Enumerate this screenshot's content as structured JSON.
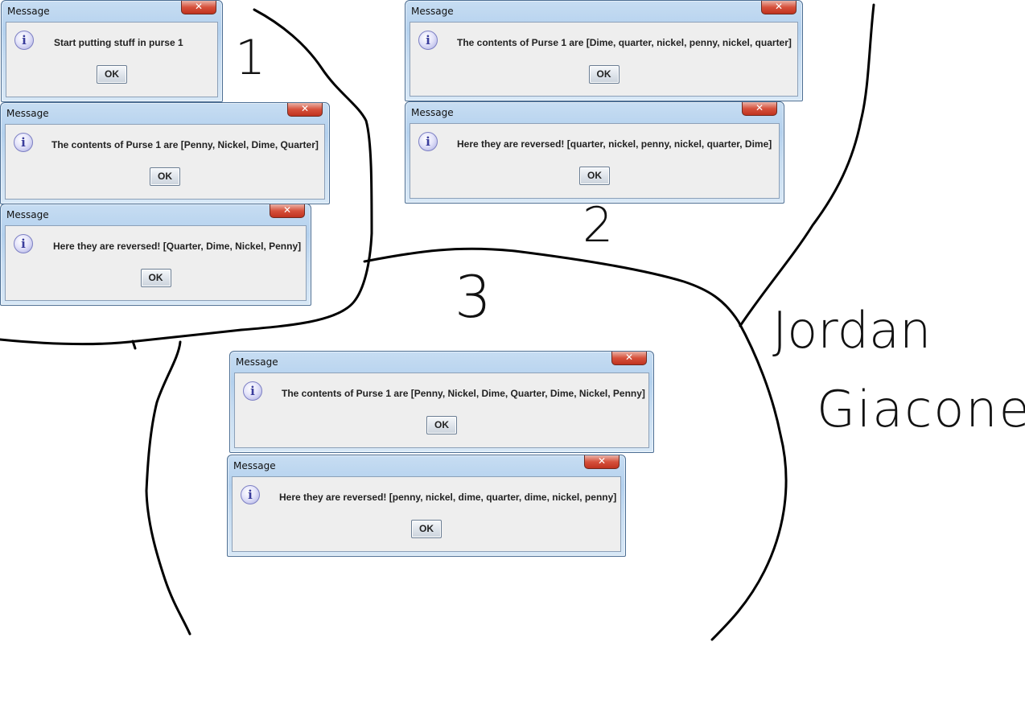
{
  "dialogs": [
    {
      "title": "Message",
      "message": "Start putting stuff in purse 1",
      "ok_label": "OK"
    },
    {
      "title": "Message",
      "message": "The contents of Purse 1 are [Penny, Nickel, Dime, Quarter]",
      "ok_label": "OK"
    },
    {
      "title": "Message",
      "message": "Here they are reversed! [Quarter, Dime, Nickel, Penny]",
      "ok_label": "OK"
    },
    {
      "title": "Message",
      "message": "The contents of Purse 1 are [Dime, quarter, nickel, penny, nickel, quarter]",
      "ok_label": "OK"
    },
    {
      "title": "Message",
      "message": "Here they are reversed! [quarter, nickel, penny, nickel, quarter, Dime]",
      "ok_label": "OK"
    },
    {
      "title": "Message",
      "message": "The contents of Purse 1 are [Penny, Nickel, Dime, Quarter, Dime, Nickel, Penny]",
      "ok_label": "OK"
    },
    {
      "title": "Message",
      "message": "Here they are reversed! [penny, nickel, dime, quarter, dime, nickel, penny]",
      "ok_label": "OK"
    }
  ],
  "annotations": {
    "section_1": "1",
    "section_2": "2",
    "section_3": "3",
    "signature_first": "Jordan",
    "signature_last": "Giacone"
  },
  "icons": {
    "info": "info-icon",
    "close": "close-icon"
  }
}
